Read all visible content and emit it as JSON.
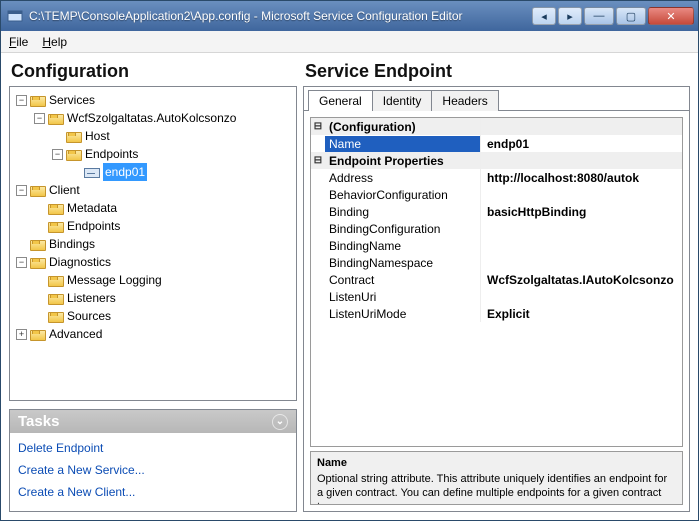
{
  "window": {
    "title": "C:\\TEMP\\ConsoleApplication2\\App.config - Microsoft Service Configuration Editor"
  },
  "menu": {
    "file": "File",
    "help": "Help"
  },
  "left": {
    "title": "Configuration",
    "tree": {
      "services": "Services",
      "svc_name": "WcfSzolgaltatas.AutoKolcsonzo",
      "host": "Host",
      "endpoints": "Endpoints",
      "endp01": "endp01",
      "client": "Client",
      "metadata": "Metadata",
      "client_endpoints": "Endpoints",
      "bindings": "Bindings",
      "diagnostics": "Diagnostics",
      "msglog": "Message Logging",
      "listeners": "Listeners",
      "sources": "Sources",
      "advanced": "Advanced"
    }
  },
  "tasks": {
    "title": "Tasks",
    "delete": "Delete Endpoint",
    "new_service": "Create a New Service...",
    "new_client": "Create a New Client..."
  },
  "right": {
    "title": "Service Endpoint",
    "tabs": {
      "general": "General",
      "identity": "Identity",
      "headers": "Headers"
    },
    "grid": {
      "cat_config": "(Configuration)",
      "name_label": "Name",
      "name_value": "endp01",
      "cat_ep": "Endpoint Properties",
      "address_label": "Address",
      "address_value": "http://localhost:8080/autok",
      "behcfg_label": "BehaviorConfiguration",
      "behcfg_value": "",
      "binding_label": "Binding",
      "binding_value": "basicHttpBinding",
      "bindcfg_label": "BindingConfiguration",
      "bindcfg_value": "",
      "bindname_label": "BindingName",
      "bindname_value": "",
      "bindns_label": "BindingNamespace",
      "bindns_value": "",
      "contract_label": "Contract",
      "contract_value": "WcfSzolgaltatas.IAutoKolcsonzo",
      "listenuri_label": "ListenUri",
      "listenuri_value": "",
      "listenmode_label": "ListenUriMode",
      "listenmode_value": "Explicit"
    },
    "help": {
      "name": "Name",
      "desc": "Optional string attribute. This attribute uniquely identifies an endpoint for a given contract. You can define multiple endpoints for a given contract type...."
    }
  }
}
